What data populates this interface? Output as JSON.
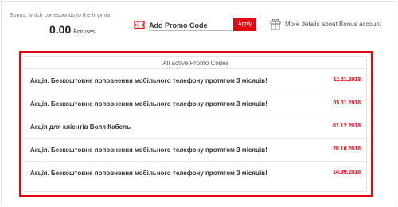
{
  "bonus": {
    "caption": "Bonus, which corresponds to the hryvnia",
    "amount": "0.00",
    "unit": "Bonuses"
  },
  "promo_input": {
    "placeholder": "Add Promo Code",
    "value": "",
    "apply_label": "Apply"
  },
  "bonus_details": {
    "label": "More details about Bonus account"
  },
  "promo_codes": {
    "title": "All active Promo Codes",
    "items": [
      {
        "name": "Акція. Безкоштовне поповнення мобільного телефону протягом 3 місяців!",
        "date": "11.11.2018"
      },
      {
        "name": "Акція. Безкоштовне поповнення мобільного телефону протягом 3 місяців!",
        "date": "05.11.2018"
      },
      {
        "name": "Акція для клієнтів Воля Кабель",
        "date": "01.12.2018"
      },
      {
        "name": "Акція. Безкоштовне поповнення мобільного телефону протягом 3 місяців!",
        "date": "28.10.2018"
      },
      {
        "name": "Акція. Безкоштовне поповнення мобільного телефону протягом 3 місяців!",
        "date": "14.09.2018"
      }
    ]
  },
  "colors": {
    "accent": "#e30613",
    "text": "#333333",
    "muted": "#777777",
    "border": "#e4e4e4"
  },
  "icons": {
    "promo": "ticket-icon",
    "details": "gift-icon"
  }
}
